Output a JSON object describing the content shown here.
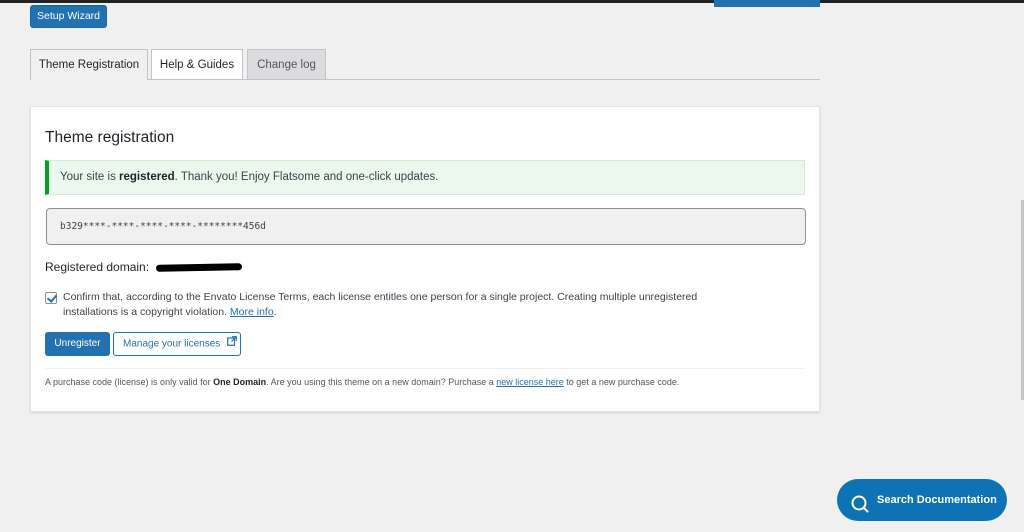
{
  "toolbar": {
    "setup_wizard_label": "Setup Wizard"
  },
  "tabs": [
    {
      "label": "Theme Registration",
      "active": true
    },
    {
      "label": "Help & Guides",
      "active": false
    },
    {
      "label": "Change log",
      "active": false
    }
  ],
  "registration": {
    "title": "Theme registration",
    "notice": {
      "prefix": "Your site is ",
      "bold": "registered",
      "suffix": ". Thank you! Enjoy Flatsome and one-click updates."
    },
    "purchase_code": "b329****-****-****-****-********456d",
    "domain_label": "Registered domain:",
    "confirm": {
      "checked": true,
      "text": "Confirm that, according to the Envato License Terms, each license entitles one person for a single project. Creating multiple unregistered installations is a copyright violation. ",
      "link": "More info",
      "after_link": "."
    },
    "unregister_label": "Unregister",
    "manage_label": "Manage your licenses",
    "footnote": {
      "part1": "A purchase code (license) is only valid for ",
      "bold": "One Domain",
      "part2": ". Are you using this theme on a new domain? Purchase a ",
      "link": "new license here",
      "part3": " to get a new purchase code."
    }
  },
  "help_widget": {
    "label": "Search Documentation"
  },
  "colors": {
    "primary": "#2271b1",
    "success": "#00a32a",
    "widget": "#0d73b5"
  }
}
